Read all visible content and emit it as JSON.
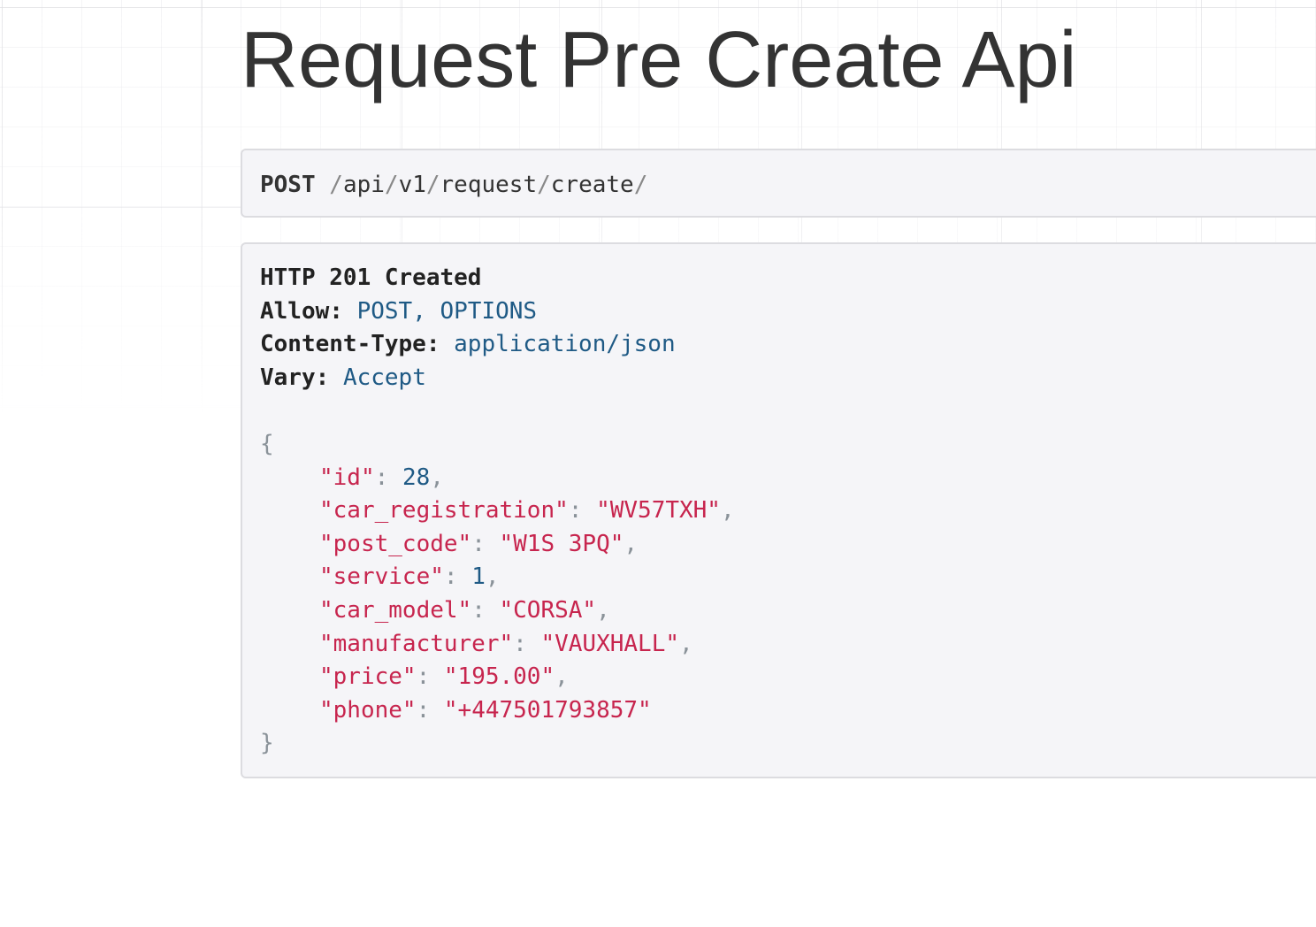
{
  "page": {
    "title": "Request Pre Create Api"
  },
  "request": {
    "method": "POST",
    "path_segments": [
      "api",
      "v1",
      "request",
      "create"
    ]
  },
  "response": {
    "status": "HTTP 201 Created",
    "headers": [
      {
        "key": "Allow:",
        "value": "POST, OPTIONS"
      },
      {
        "key": "Content-Type:",
        "value": "application/json"
      },
      {
        "key": "Vary:",
        "value": "Accept"
      }
    ],
    "body": {
      "open_brace": "{",
      "close_brace": "}",
      "fields": [
        {
          "key": "\"id\"",
          "value": "28",
          "type": "number"
        },
        {
          "key": "\"car_registration\"",
          "value": "\"WV57TXH\"",
          "type": "string"
        },
        {
          "key": "\"post_code\"",
          "value": "\"W1S 3PQ\"",
          "type": "string"
        },
        {
          "key": "\"service\"",
          "value": "1",
          "type": "number"
        },
        {
          "key": "\"car_model\"",
          "value": "\"CORSA\"",
          "type": "string"
        },
        {
          "key": "\"manufacturer\"",
          "value": "\"VAUXHALL\"",
          "type": "string"
        },
        {
          "key": "\"price\"",
          "value": "\"195.00\"",
          "type": "string"
        },
        {
          "key": "\"phone\"",
          "value": "\"+447501793857\"",
          "type": "string"
        }
      ]
    }
  },
  "colors": {
    "title": "#333333",
    "panel_bg": "#f5f5f8",
    "panel_border": "#dcdce0",
    "json_string": "#c7254e",
    "json_number": "#1f5a85",
    "header_value": "#1f5a85"
  }
}
